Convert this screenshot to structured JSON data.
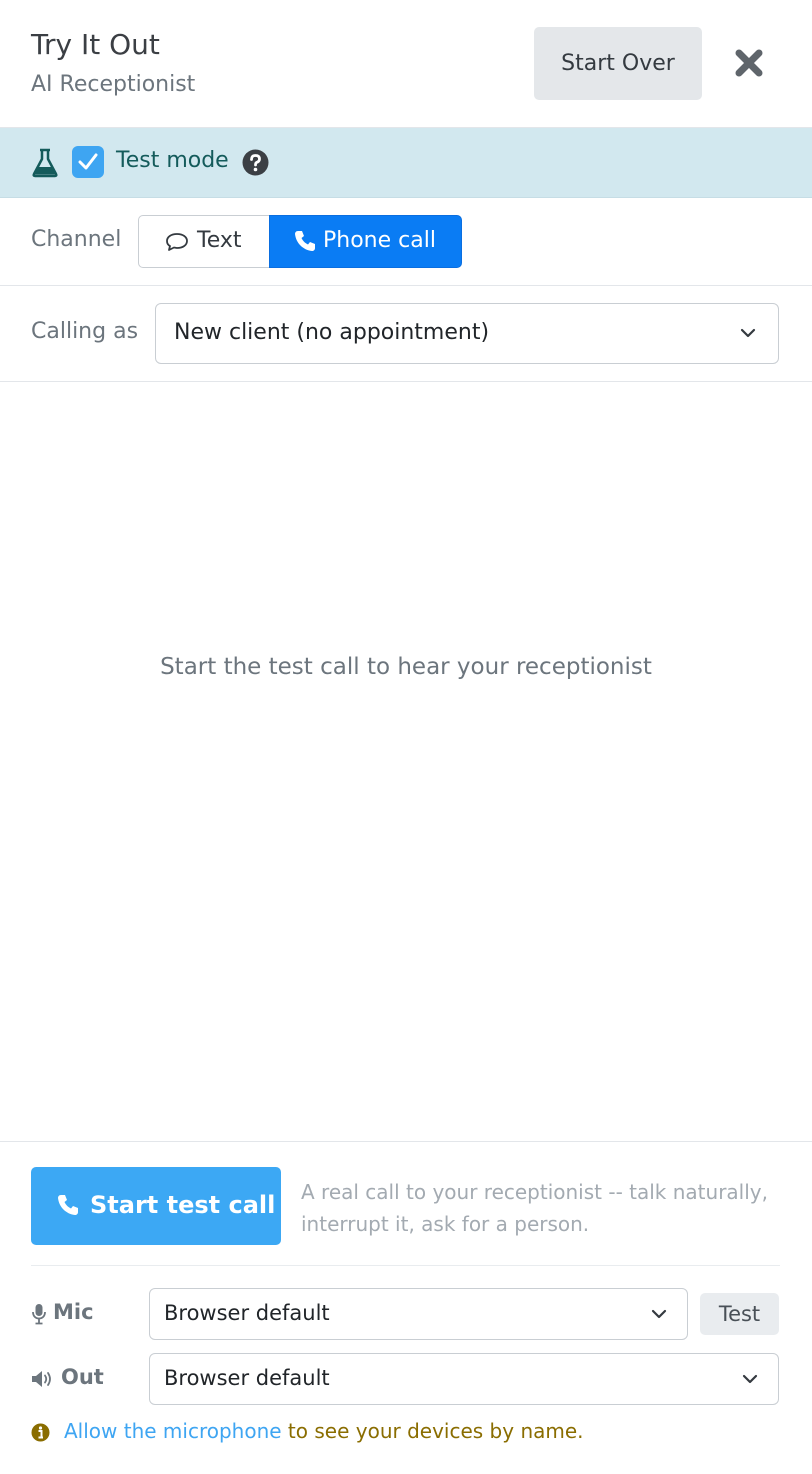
{
  "header": {
    "title": "Try It Out",
    "subtitle": "AI Receptionist",
    "start_over_label": "Start Over",
    "close_icon": "close-icon"
  },
  "test_mode": {
    "label": "Test mode",
    "checked": true,
    "icons": [
      "flask-icon",
      "help-icon"
    ]
  },
  "channel": {
    "label": "Channel",
    "options": [
      {
        "label": "Text",
        "icon": "speech-bubble-icon",
        "selected": false
      },
      {
        "label": "Phone call",
        "icon": "phone-icon",
        "selected": true
      }
    ]
  },
  "calling_as": {
    "label": "Calling as",
    "value": "New client (no appointment)"
  },
  "main": {
    "empty_message": "Start the test call to hear your receptionist"
  },
  "call": {
    "button_label": "Start test call",
    "hint": "A real call to your receptionist -- talk naturally, interrupt it, ask for a person."
  },
  "devices": {
    "mic_label": "Mic",
    "mic_value": "Browser default",
    "test_label": "Test",
    "out_label": "Out",
    "out_value": "Browser default"
  },
  "notice": {
    "link_text": "Allow the microphone",
    "rest_text": " to see your devices by name."
  },
  "colors": {
    "accent_blue": "#0a7cf4",
    "call_button_blue": "#3ca8f4",
    "banner_bg": "#d2e8ef",
    "notice_text": "#8a6d00"
  }
}
